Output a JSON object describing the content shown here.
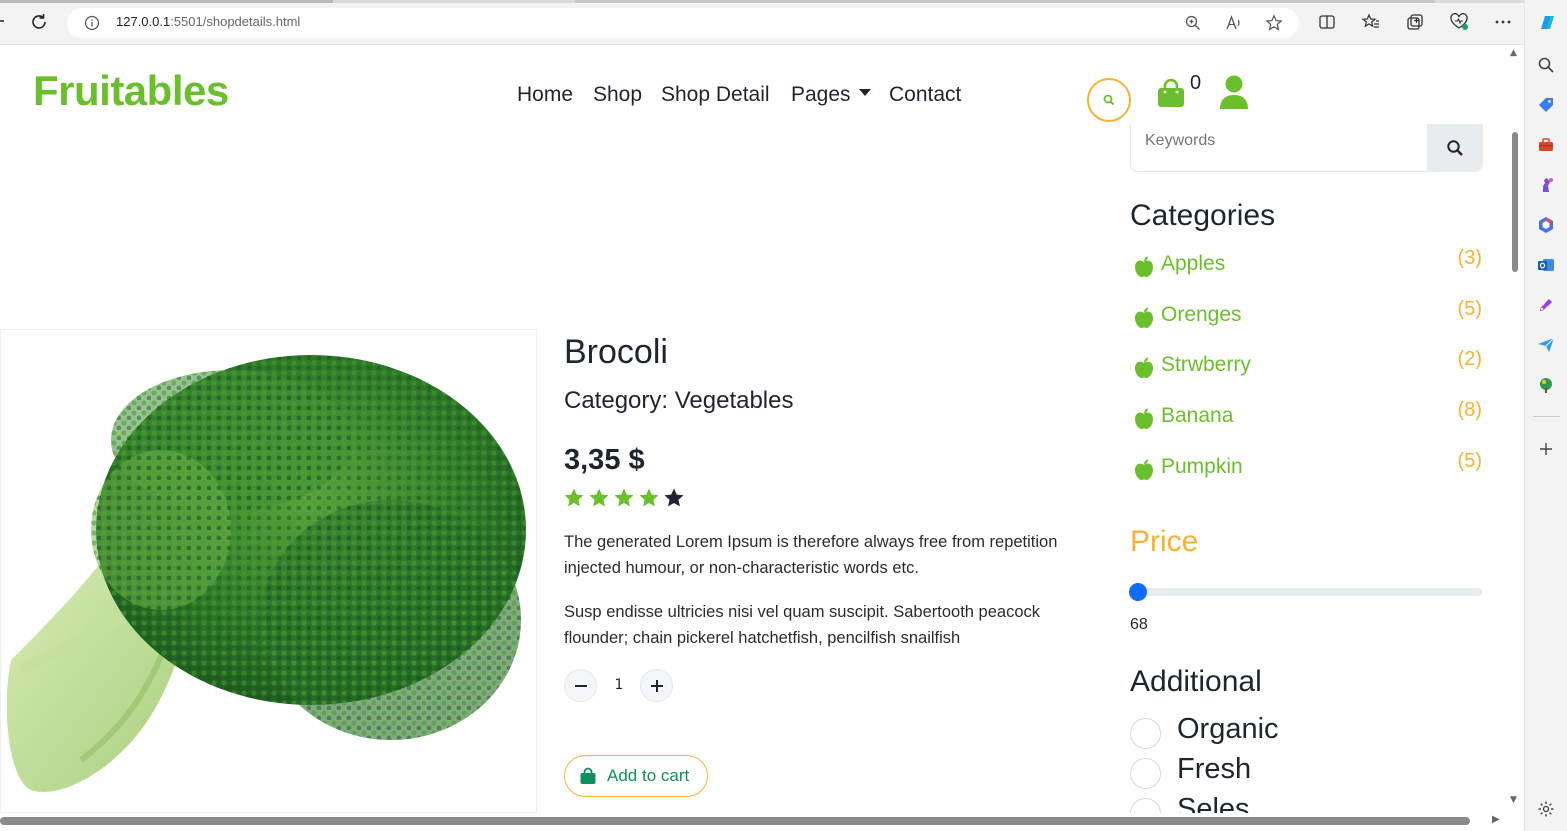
{
  "browser": {
    "url_host": "127.0.0.1",
    "url_rest": ":5501/shopdetails.html"
  },
  "navbar": {
    "brand": "Fruitables",
    "links": [
      "Home",
      "Shop",
      "Shop Detail",
      "Pages",
      "Contact"
    ],
    "cart_count": "0"
  },
  "product": {
    "name": "Brocoli",
    "category": "Category: Vegetables",
    "price": "3,35 $",
    "rating": 4,
    "rating_max": 5,
    "description_1": "The generated Lorem Ipsum is therefore always free from repetition injected humour, or non-characteristic words etc.",
    "description_2": "Susp endisse ultricies nisi vel quam suscipit. Sabertooth peacock flounder; chain pickerel hatchetfish, pencilfish snailfish",
    "quantity": "1",
    "add_to_cart_label": "Add to cart"
  },
  "sidebar": {
    "search_placeholder": "Keywords",
    "categories_title": "Categories",
    "categories": [
      {
        "name": "Apples",
        "count": "(3)"
      },
      {
        "name": "Orenges",
        "count": "(5)"
      },
      {
        "name": "Strwberry",
        "count": "(2)"
      },
      {
        "name": "Banana",
        "count": "(8)"
      },
      {
        "name": "Pumpkin",
        "count": "(5)"
      }
    ],
    "price_title": "Price",
    "price_value": "68",
    "additional_title": "Additional",
    "additional_options": [
      "Organic",
      "Fresh",
      "Seles"
    ]
  },
  "colors": {
    "brand_green": "#6cbf2c",
    "accent_orange": "#f6b332",
    "dark_text": "#1f2530",
    "slider_blue": "#0d6efd"
  }
}
